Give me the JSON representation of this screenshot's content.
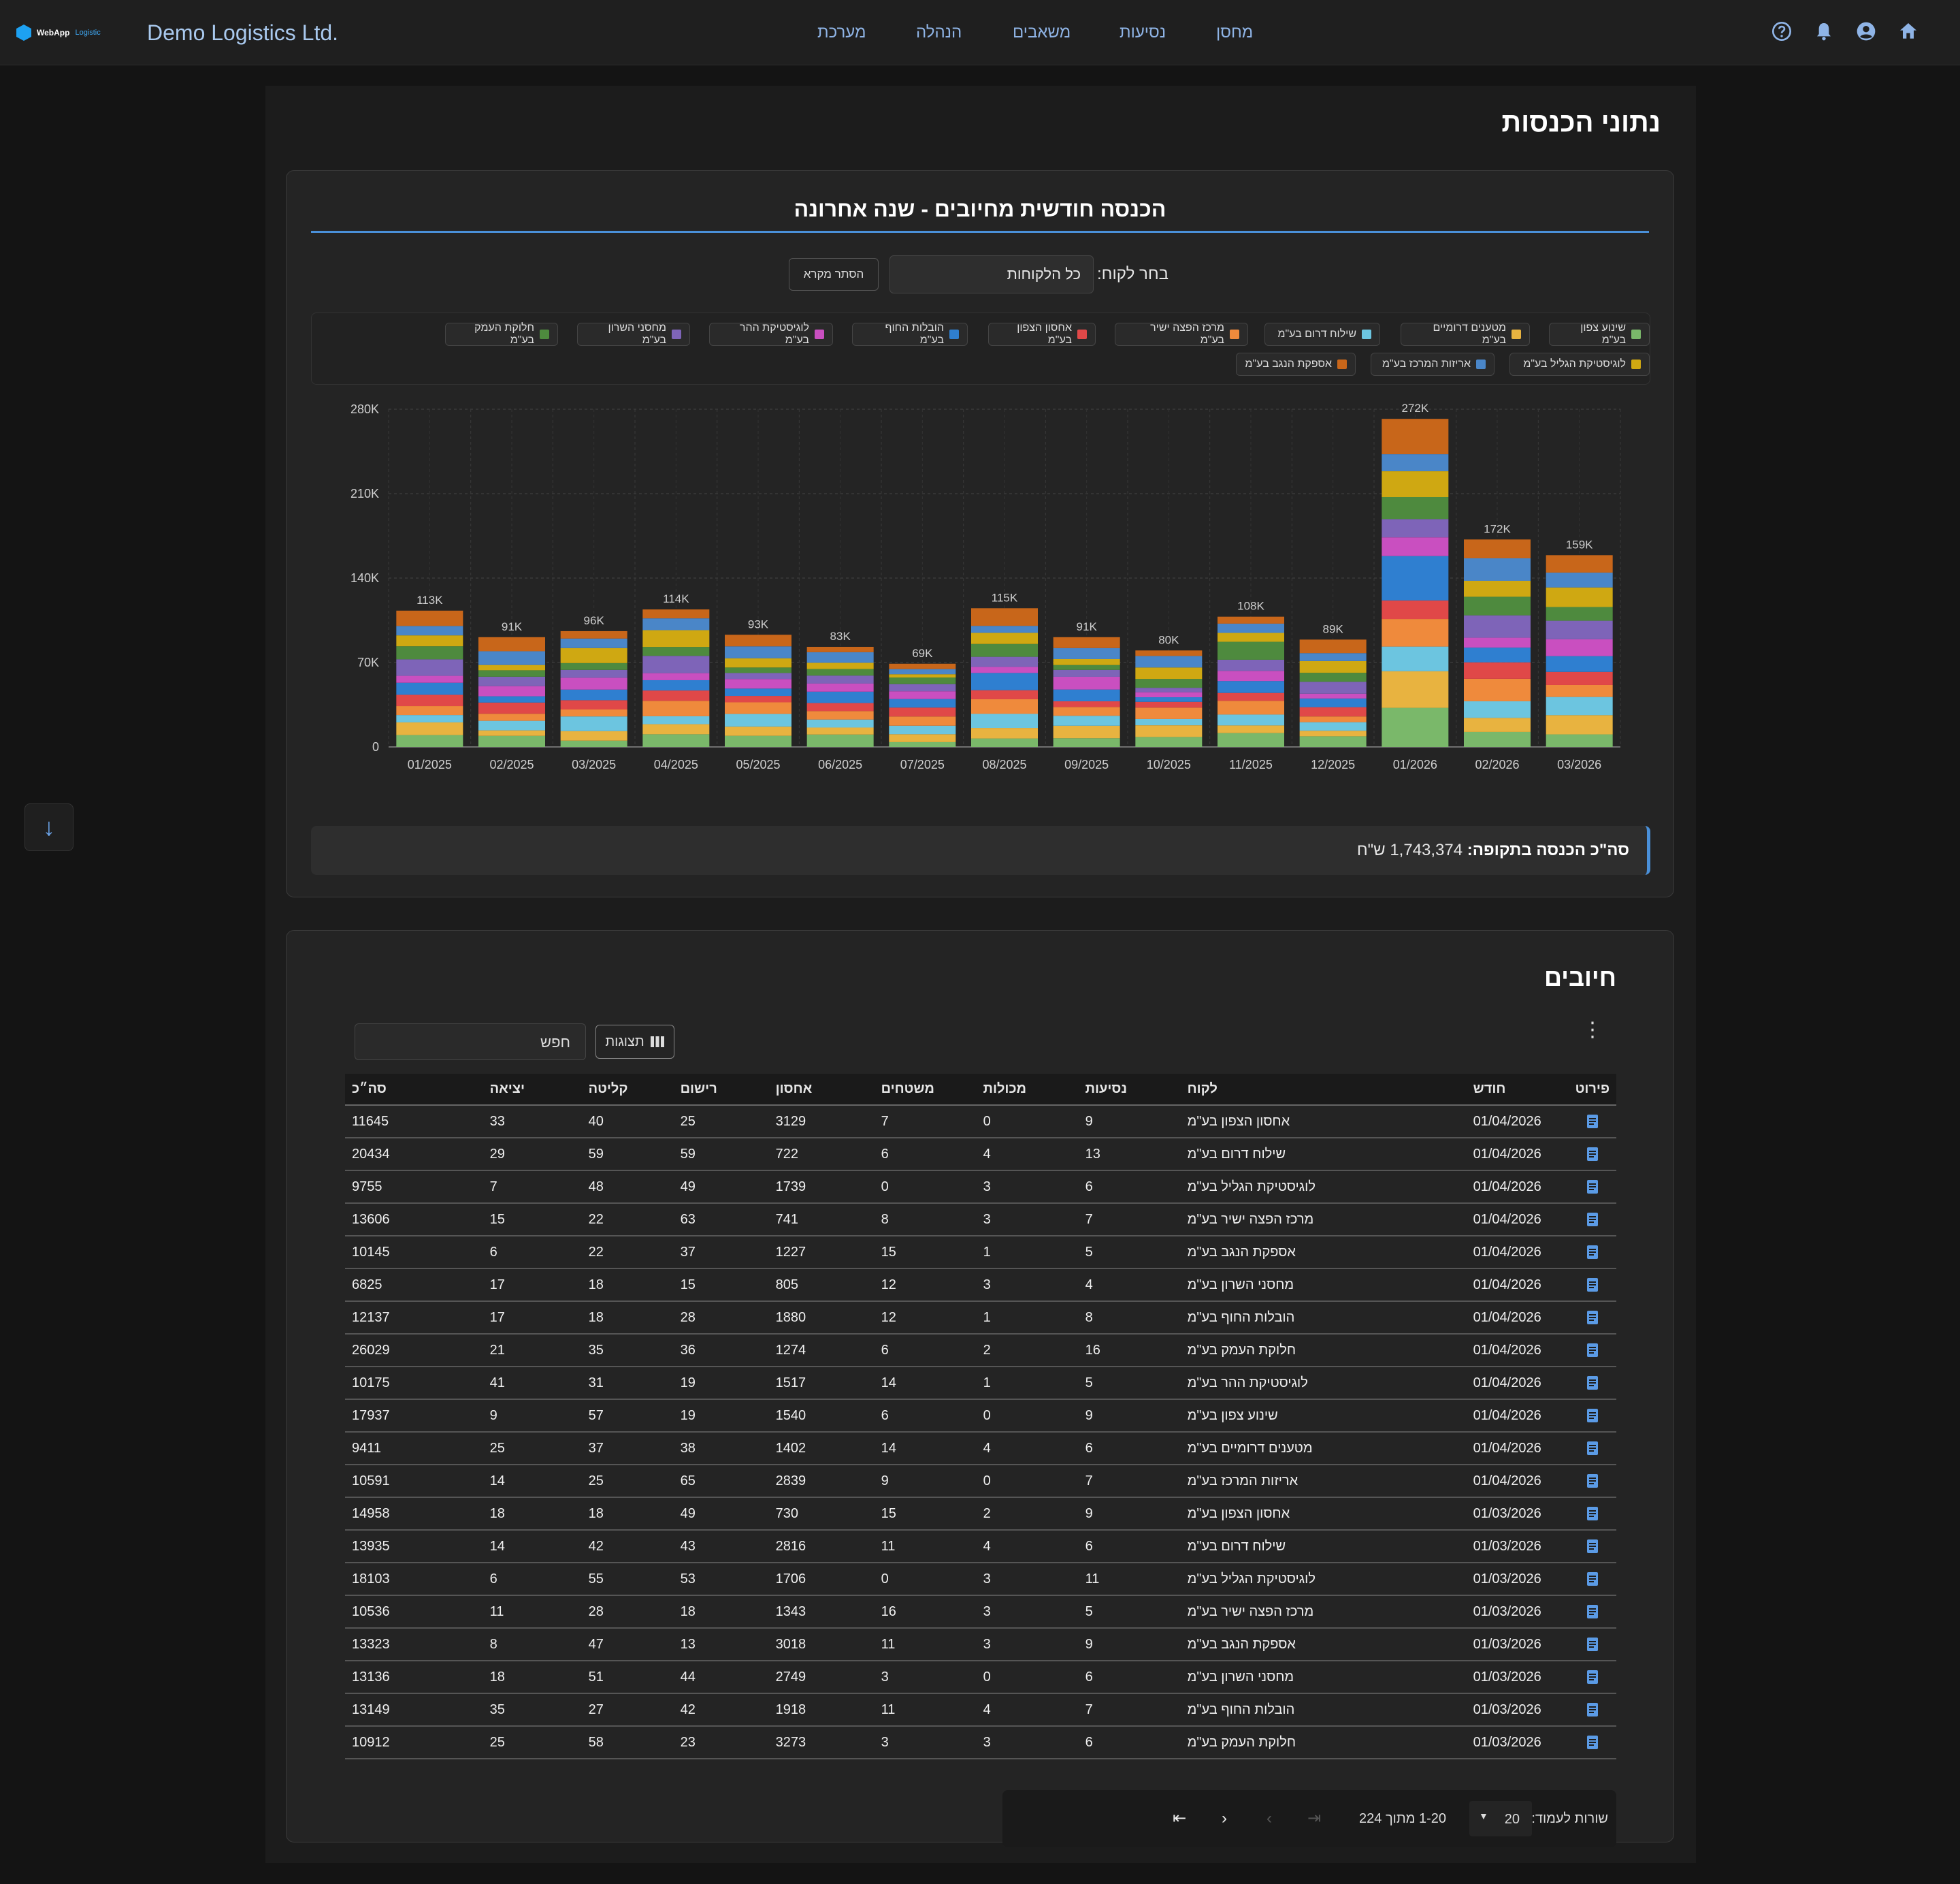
{
  "header": {
    "logo_text": "WebApp",
    "logo_sub": "Logistic",
    "company": "Demo Logistics Ltd.",
    "nav": [
      "מחסן",
      "נסיעות",
      "משאבים",
      "הנהלה",
      "מערכת"
    ]
  },
  "page_title": "נתוני הכנסות",
  "chart_card": {
    "title": "הכנסה חודשית מחיובים - שנה אחרונה",
    "select_label": "בחר לקוח:",
    "select_value": "כל הלקוחות",
    "hide_legend": "הסתר מקרא",
    "total_label": "סה\"כ הכנסה בתקופה:",
    "total_value": "1,743,374 ש\"ח"
  },
  "chart_data": {
    "type": "bar",
    "stacked": true,
    "categories": [
      "01/2025",
      "02/2025",
      "03/2025",
      "04/2025",
      "05/2025",
      "06/2025",
      "07/2025",
      "08/2025",
      "09/2025",
      "10/2025",
      "11/2025",
      "12/2025",
      "01/2026",
      "02/2026",
      "03/2026"
    ],
    "totals": [
      113,
      91,
      96,
      114,
      93,
      83,
      69,
      115,
      91,
      80,
      108,
      89,
      272,
      172,
      159
    ],
    "total_labels": [
      "113K",
      "91K",
      "96K",
      "114K",
      "93K",
      "83K",
      "69K",
      "115K",
      "91K",
      "80K",
      "108K",
      "89K",
      "272K",
      "172K",
      "159K"
    ],
    "y_ticks": [
      "0",
      "70K",
      "140K",
      "210K",
      "280K"
    ],
    "ylim": [
      0,
      280
    ],
    "grid": true,
    "legend_placement": "top",
    "series": [
      {
        "name": "שינוע צפון בע\"מ",
        "color": "#7ab86a"
      },
      {
        "name": "מטענים דרומיים בע\"מ",
        "color": "#e8b340"
      },
      {
        "name": "שילוח דרום בע\"מ",
        "color": "#6cc5e0"
      },
      {
        "name": "מרכז הפצה ישיר בע\"מ",
        "color": "#ef8a3c"
      },
      {
        "name": "אחסון הצפון בע\"מ",
        "color": "#e04848"
      },
      {
        "name": "הובלות החוף בע\"מ",
        "color": "#2f7fd0"
      },
      {
        "name": "לוגיסטיקת ההר בע\"מ",
        "color": "#c94fc0"
      },
      {
        "name": "מחסני השרון בע\"מ",
        "color": "#7e64b8"
      },
      {
        "name": "חלוקת העמק בע\"מ",
        "color": "#4e8a3e"
      },
      {
        "name": "לוגיסטיקת הגליל בע\"מ",
        "color": "#cfa812"
      },
      {
        "name": "אריזות המרכז בע\"מ",
        "color": "#4a86c8"
      },
      {
        "name": "אספקת הנגב בע\"מ",
        "color": "#c8661a"
      }
    ]
  },
  "table_card": {
    "title": "חיובים",
    "columns_btn": "תצוגות",
    "search_placeholder": "חפש",
    "headers": [
      "פירוט",
      "חודש",
      "לקוח",
      "נסיעות",
      "מכולות",
      "משטחים",
      "אחסון",
      "רישום",
      "קליטה",
      "יציאה",
      "סה״כ"
    ],
    "rows": [
      [
        "01/04/2026",
        "אחסון הצפון בע\"מ",
        "9",
        "0",
        "7",
        "3129",
        "25",
        "40",
        "33",
        "11645"
      ],
      [
        "01/04/2026",
        "שילוח דרום בע\"מ",
        "13",
        "4",
        "6",
        "722",
        "59",
        "59",
        "29",
        "20434"
      ],
      [
        "01/04/2026",
        "לוגיסטיקת הגליל בע\"מ",
        "6",
        "3",
        "0",
        "1739",
        "49",
        "48",
        "7",
        "9755"
      ],
      [
        "01/04/2026",
        "מרכז הפצה ישיר בע\"מ",
        "7",
        "3",
        "8",
        "741",
        "63",
        "22",
        "15",
        "13606"
      ],
      [
        "01/04/2026",
        "אספקת הנגב בע\"מ",
        "5",
        "1",
        "15",
        "1227",
        "37",
        "22",
        "6",
        "10145"
      ],
      [
        "01/04/2026",
        "מחסני השרון בע\"מ",
        "4",
        "3",
        "12",
        "805",
        "15",
        "18",
        "17",
        "6825"
      ],
      [
        "01/04/2026",
        "הובלות החוף בע\"מ",
        "8",
        "1",
        "12",
        "1880",
        "28",
        "18",
        "17",
        "12137"
      ],
      [
        "01/04/2026",
        "חלוקת העמק בע\"מ",
        "16",
        "2",
        "6",
        "1274",
        "36",
        "35",
        "21",
        "26029"
      ],
      [
        "01/04/2026",
        "לוגיסטיקת ההר בע\"מ",
        "5",
        "1",
        "14",
        "1517",
        "19",
        "31",
        "41",
        "10175"
      ],
      [
        "01/04/2026",
        "שינוע צפון בע\"מ",
        "9",
        "0",
        "6",
        "1540",
        "19",
        "57",
        "9",
        "17937"
      ],
      [
        "01/04/2026",
        "מטענים דרומיים בע\"מ",
        "6",
        "4",
        "14",
        "1402",
        "38",
        "37",
        "25",
        "9411"
      ],
      [
        "01/04/2026",
        "אריזות המרכז בע\"מ",
        "7",
        "0",
        "9",
        "2839",
        "65",
        "25",
        "14",
        "10591"
      ],
      [
        "01/03/2026",
        "אחסון הצפון בע\"מ",
        "9",
        "2",
        "15",
        "730",
        "49",
        "18",
        "18",
        "14958"
      ],
      [
        "01/03/2026",
        "שילוח דרום בע\"מ",
        "6",
        "4",
        "11",
        "2816",
        "43",
        "42",
        "14",
        "13935"
      ],
      [
        "01/03/2026",
        "לוגיסטיקת הגליל בע\"מ",
        "11",
        "3",
        "0",
        "1706",
        "53",
        "55",
        "6",
        "18103"
      ],
      [
        "01/03/2026",
        "מרכז הפצה ישיר בע\"מ",
        "5",
        "3",
        "16",
        "1343",
        "18",
        "28",
        "11",
        "10536"
      ],
      [
        "01/03/2026",
        "אספקת הנגב בע\"מ",
        "9",
        "3",
        "11",
        "3018",
        "13",
        "47",
        "8",
        "13323"
      ],
      [
        "01/03/2026",
        "מחסני השרון בע\"מ",
        "6",
        "0",
        "3",
        "2749",
        "44",
        "51",
        "18",
        "13136"
      ],
      [
        "01/03/2026",
        "הובלות החוף בע\"מ",
        "7",
        "4",
        "11",
        "1918",
        "42",
        "27",
        "35",
        "13149"
      ],
      [
        "01/03/2026",
        "חלוקת העמק בע\"מ",
        "6",
        "3",
        "3",
        "3273",
        "23",
        "58",
        "25",
        "10912"
      ]
    ],
    "pager": {
      "rows_per_page_label": "שורות לעמוד:",
      "rows_per_page": "20",
      "range": "1-20 מתוך 224"
    }
  }
}
